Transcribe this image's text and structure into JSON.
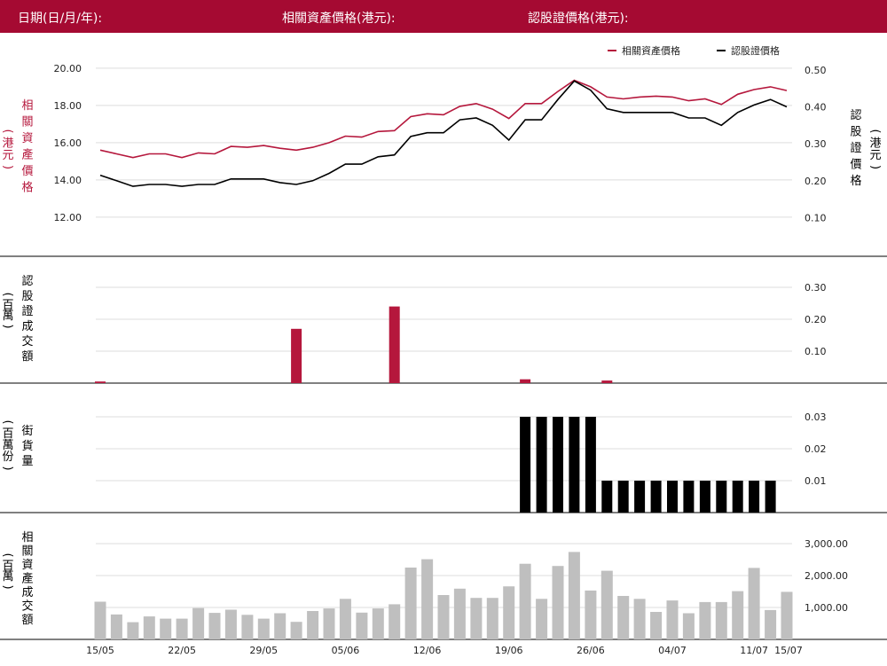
{
  "header": {
    "date_label": "日期(日/月/年):",
    "underlying_label": "相關資產價格(港元):",
    "warrant_label": "認股證價格(港元):"
  },
  "colors": {
    "header_bg": "#a50a32",
    "underlying": "#b5173c",
    "warrant": "#000000",
    "asset_turnover": "#bfbfbf"
  },
  "legend": {
    "underlying": "相關資產價格",
    "warrant": "認股證價格"
  },
  "axis_labels": {
    "price_left": "相關資產價格",
    "price_left_unit": "(港元)",
    "price_right": "認股證價格",
    "price_right_unit": "(港元)",
    "warrant_turnover": "認股證成交額",
    "warrant_turnover_unit": "(百萬)",
    "outstanding": "街貨量",
    "outstanding_unit": "(百萬份)",
    "asset_turnover": "相關資產成交額",
    "asset_turnover_unit": "(百萬)"
  },
  "chart_data": [
    {
      "type": "line",
      "name": "price",
      "y_left_ticks": [
        "20.00",
        "18.00",
        "16.00",
        "14.00",
        "12.00"
      ],
      "y_left_range": [
        10.9,
        20.9
      ],
      "y_right_ticks": [
        "0.50",
        "0.40",
        "0.30",
        "0.20",
        "0.10"
      ],
      "y_right_range": [
        0.046,
        0.55
      ],
      "series": [
        {
          "name": "相關資產價格",
          "axis": "left",
          "values": [
            15.6,
            15.4,
            15.2,
            15.4,
            15.4,
            15.2,
            15.45,
            15.4,
            15.8,
            15.75,
            15.85,
            15.7,
            15.6,
            15.75,
            16.0,
            16.35,
            16.3,
            16.6,
            16.65,
            17.4,
            17.55,
            17.5,
            17.95,
            18.1,
            17.8,
            17.3,
            18.1,
            18.1,
            18.75,
            19.35,
            19.0,
            18.45,
            18.35,
            18.45,
            18.5,
            18.45,
            18.25,
            18.35,
            18.05,
            18.6,
            18.85,
            19.0,
            18.8
          ]
        },
        {
          "name": "認股證價格",
          "axis": "right",
          "values": [
            0.215,
            0.2,
            0.185,
            0.19,
            0.19,
            0.185,
            0.19,
            0.19,
            0.205,
            0.205,
            0.205,
            0.195,
            0.19,
            0.2,
            0.22,
            0.245,
            0.245,
            0.265,
            0.27,
            0.32,
            0.33,
            0.33,
            0.365,
            0.37,
            0.35,
            0.31,
            0.365,
            0.365,
            0.42,
            0.47,
            0.445,
            0.395,
            0.385,
            0.385,
            0.385,
            0.385,
            0.37,
            0.37,
            0.35,
            0.385,
            0.405,
            0.42,
            0.4
          ]
        }
      ]
    },
    {
      "type": "bar",
      "name": "warrant_turnover",
      "y_ticks": [
        "0.30",
        "0.20",
        "0.10"
      ],
      "y_range": [
        0,
        0.3
      ],
      "values": [
        0.005,
        0,
        0,
        0,
        0,
        0,
        0,
        0,
        0,
        0,
        0,
        0,
        0.17,
        0,
        0,
        0,
        0,
        0,
        0.24,
        0,
        0,
        0,
        0,
        0,
        0,
        0,
        0.012,
        0,
        0,
        0,
        0,
        0.008,
        0,
        0,
        0,
        0,
        0,
        0,
        0,
        0,
        0,
        0,
        0
      ]
    },
    {
      "type": "bar",
      "name": "outstanding",
      "y_ticks": [
        "0.03",
        "0.02",
        "0.01"
      ],
      "y_range": [
        0,
        0.03
      ],
      "values": [
        0,
        0,
        0,
        0,
        0,
        0,
        0,
        0,
        0,
        0,
        0,
        0,
        0,
        0,
        0,
        0,
        0,
        0,
        0,
        0,
        0,
        0,
        0,
        0,
        0,
        0,
        0.03,
        0.03,
        0.03,
        0.03,
        0.03,
        0.01,
        0.01,
        0.01,
        0.01,
        0.01,
        0.01,
        0.01,
        0.01,
        0.01,
        0.01,
        0.01,
        0
      ]
    },
    {
      "type": "bar",
      "name": "asset_turnover",
      "y_ticks": [
        "3,000.00",
        "2,000.00",
        "1,000.00"
      ],
      "y_range": [
        0,
        3000
      ],
      "values": [
        1180,
        780,
        540,
        720,
        650,
        650,
        980,
        830,
        930,
        770,
        650,
        820,
        550,
        890,
        970,
        1270,
        840,
        970,
        1100,
        2250,
        2510,
        1390,
        1590,
        1300,
        1300,
        1660,
        2370,
        1270,
        2300,
        2740,
        1530,
        2150,
        1360,
        1270,
        860,
        1220,
        820,
        1170,
        1170,
        1510,
        2240,
        920,
        1490
      ]
    }
  ],
  "x_ticks": [
    {
      "label": "15/05",
      "index": 0
    },
    {
      "label": "22/05",
      "index": 5
    },
    {
      "label": "29/05",
      "index": 10
    },
    {
      "label": "05/06",
      "index": 15
    },
    {
      "label": "12/06",
      "index": 20
    },
    {
      "label": "19/06",
      "index": 25
    },
    {
      "label": "26/06",
      "index": 30
    },
    {
      "label": "04/07",
      "index": 35
    },
    {
      "label": "11/07",
      "index": 40
    },
    {
      "label": "15/07",
      "index": 42
    }
  ]
}
